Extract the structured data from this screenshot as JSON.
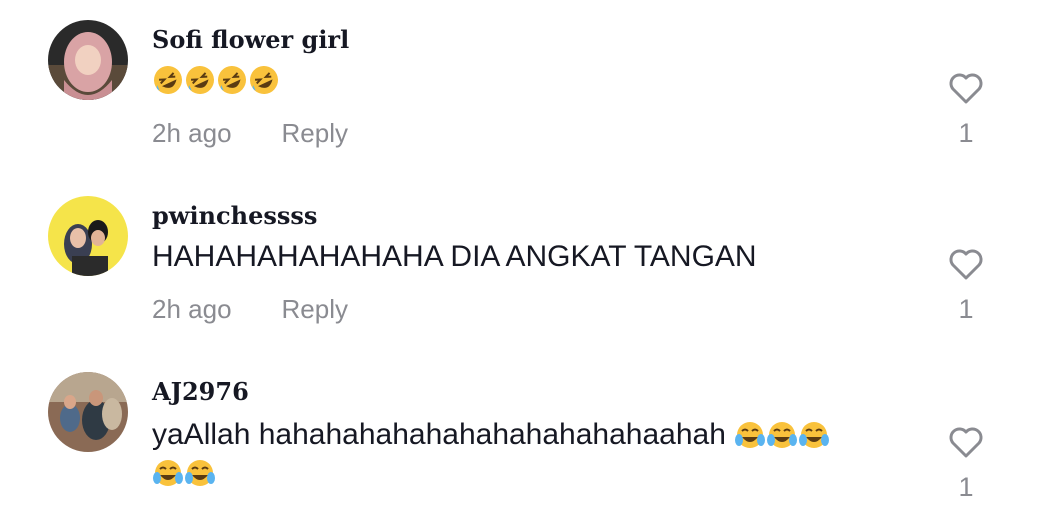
{
  "comments": [
    {
      "username": "Sofi flower girl",
      "text": "",
      "emoji_rolling_count": 4,
      "emoji_name": "rolling-on-floor-laughing-emoji",
      "time": "2h ago",
      "reply_label": "Reply",
      "likes": "1",
      "liked": false
    },
    {
      "username": "pwinchessss",
      "text": "HAHAHAHAHAHAHA DIA ANGKAT TANGAN",
      "time": "2h ago",
      "reply_label": "Reply",
      "likes": "1",
      "liked": false
    },
    {
      "username": "AJ2976",
      "text": "yaAllah hahahahahahahahahahahahaahah",
      "emoji_joy_count": 5,
      "emoji_name": "face-with-tears-of-joy-emoji",
      "time": "",
      "reply_label": "",
      "likes": "1",
      "liked": false
    }
  ],
  "colors": {
    "text": "#161823",
    "muted": "#8a8b91",
    "avatar2_bg": "#f5e44a"
  }
}
